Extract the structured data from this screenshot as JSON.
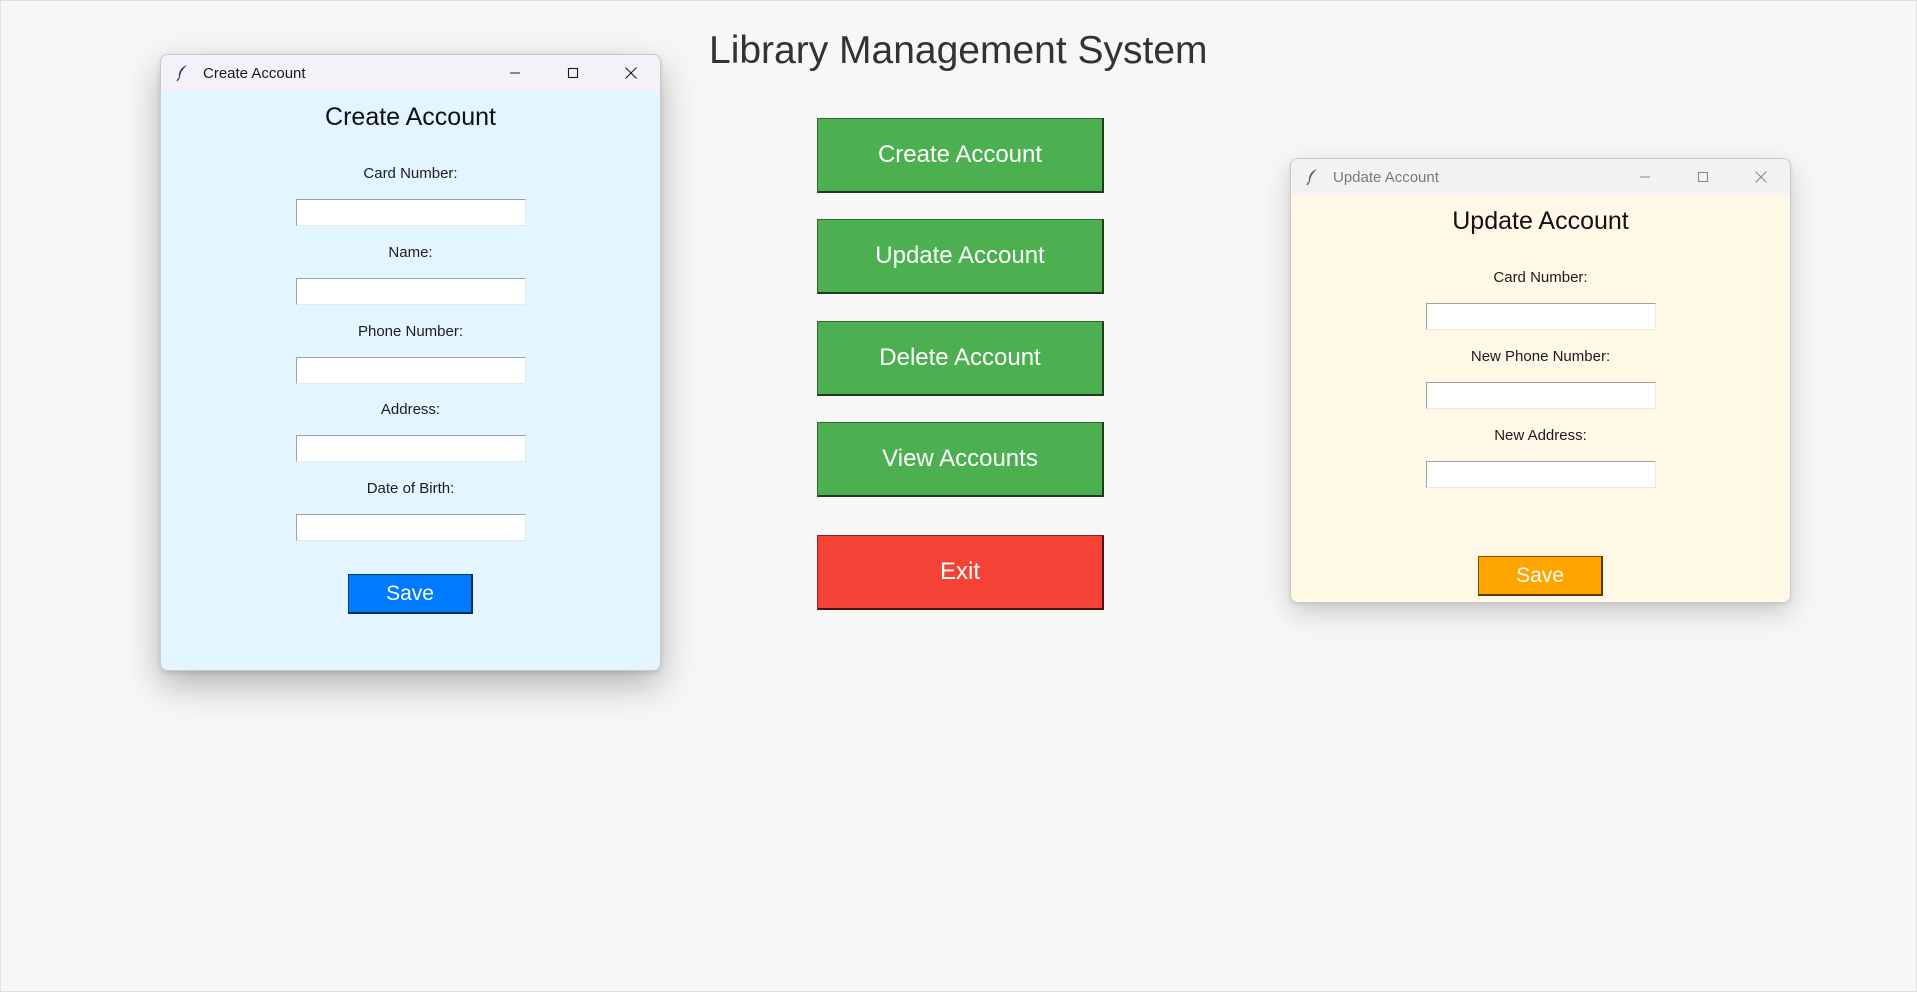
{
  "app": {
    "title": "Library Management System"
  },
  "main_menu": {
    "create_label": "Create Account",
    "update_label": "Update Account",
    "delete_label": "Delete Account",
    "view_label": "View Accounts",
    "exit_label": "Exit"
  },
  "create_window": {
    "window_title": "Create Account",
    "heading": "Create Account",
    "fields": {
      "card_number_label": "Card Number:",
      "card_number_value": "",
      "name_label": "Name:",
      "name_value": "",
      "phone_label": "Phone Number:",
      "phone_value": "",
      "address_label": "Address:",
      "address_value": "",
      "dob_label": "Date of Birth:",
      "dob_value": ""
    },
    "save_label": "Save"
  },
  "update_window": {
    "window_title": "Update Account",
    "heading": "Update Account",
    "fields": {
      "card_number_label": "Card Number:",
      "card_number_value": "",
      "phone_label": "New Phone Number:",
      "phone_value": "",
      "address_label": "New Address:",
      "address_value": ""
    },
    "save_label": "Save"
  },
  "colors": {
    "page_background": "#f7f7f7",
    "menu_button": "#4caf50",
    "exit_button": "#f44336",
    "create_window_background": "#e3f5ff",
    "update_window_background": "#fff8e6",
    "create_save_button": "#007bff",
    "update_save_button": "#ffa500"
  },
  "icons": {
    "window_icon": "feather-icon",
    "minimize": "minimize-icon",
    "maximize": "maximize-icon",
    "close": "close-icon"
  }
}
